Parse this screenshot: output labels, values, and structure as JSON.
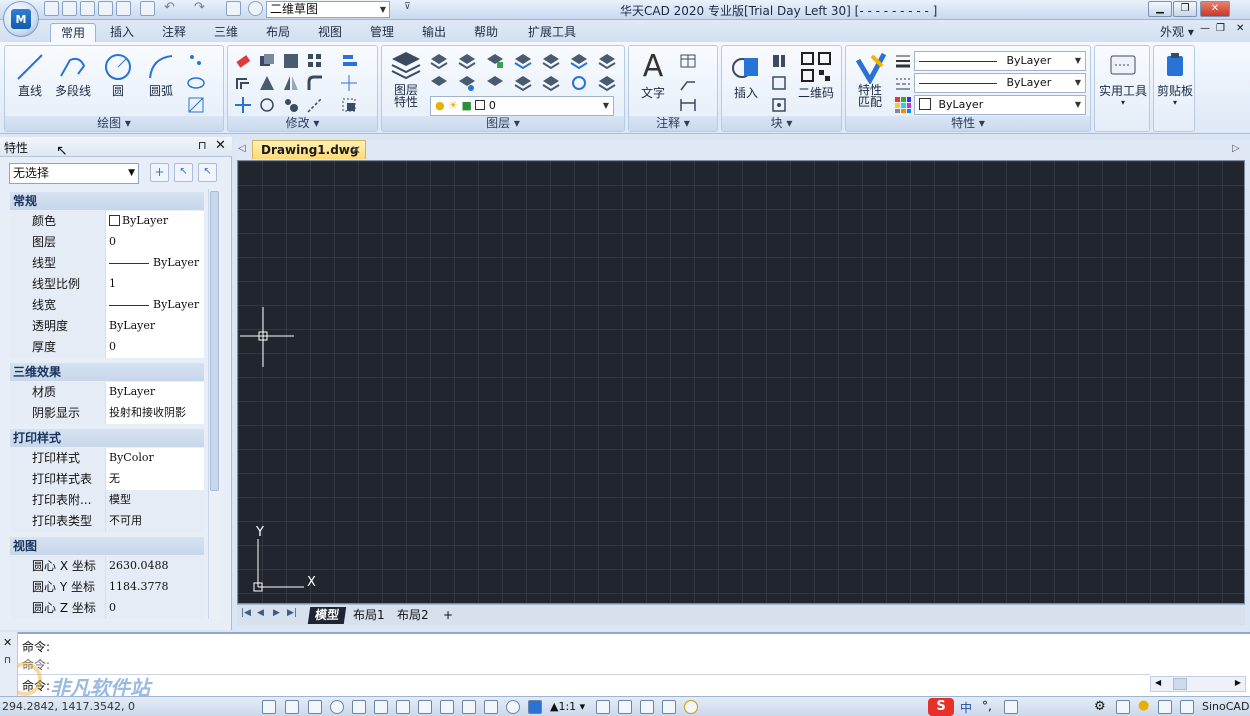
{
  "titlebar": {
    "workspace": "二维草图",
    "title": "华天CAD 2020 专业版[Trial Day Left 30]  [- - - - - - - - -  ]",
    "right_menu": "外观"
  },
  "ribbon_tabs": [
    "常用",
    "插入",
    "注释",
    "三维",
    "布局",
    "视图",
    "管理",
    "输出",
    "帮助",
    "扩展工具"
  ],
  "ribbon": {
    "draw": {
      "title": "绘图",
      "line": "直线",
      "polyline": "多段线",
      "circle": "圆",
      "arc": "圆弧"
    },
    "modify": {
      "title": "修改"
    },
    "layers": {
      "title": "图层",
      "layer_props_l1": "图层",
      "layer_props_l2": "特性",
      "current_layer": "0"
    },
    "annotate": {
      "title": "注释",
      "text": "文字"
    },
    "block": {
      "title": "块",
      "insert": "插入",
      "qrcode": "二维码"
    },
    "properties": {
      "title": "特性",
      "match_l1": "特性",
      "match_l2": "匹配",
      "lineweight": "ByLayer",
      "linetype": "ByLayer",
      "color": "ByLayer"
    },
    "utilities": {
      "label": "实用工具"
    },
    "clipboard": {
      "label": "剪贴板"
    }
  },
  "props_panel": {
    "title": "特性",
    "selection": "无选择",
    "sections": {
      "general": "常规",
      "three_d": "三维效果",
      "print": "打印样式",
      "view": "视图"
    },
    "rows": {
      "color": {
        "k": "颜色",
        "v": "ByLayer"
      },
      "layer": {
        "k": "图层",
        "v": "0"
      },
      "linetype": {
        "k": "线型",
        "v": "ByLayer"
      },
      "ltscale": {
        "k": "线型比例",
        "v": "1"
      },
      "lineweight": {
        "k": "线宽",
        "v": "ByLayer"
      },
      "transparency": {
        "k": "透明度",
        "v": "ByLayer"
      },
      "thickness": {
        "k": "厚度",
        "v": "0"
      },
      "material": {
        "k": "材质",
        "v": "ByLayer"
      },
      "shadow": {
        "k": "阴影显示",
        "v": "投射和接收阴影"
      },
      "plotstyle": {
        "k": "打印样式",
        "v": "ByColor"
      },
      "plottable": {
        "k": "打印样式表",
        "v": "无"
      },
      "plotattached": {
        "k": "打印表附...",
        "v": "模型"
      },
      "plottype": {
        "k": "打印表类型",
        "v": "不可用"
      },
      "cx": {
        "k": "圆心 X 坐标",
        "v": "2630.0488"
      },
      "cy": {
        "k": "圆心 Y 坐标",
        "v": "1184.3778"
      },
      "cz": {
        "k": "圆心 Z 坐标",
        "v": "0"
      }
    }
  },
  "document": {
    "tab": "Drawing1.dwg"
  },
  "layout_tabs": {
    "model": "模型",
    "layout1": "布局1",
    "layout2": "布局2",
    "add": "+"
  },
  "ucs": {
    "x": "X",
    "y": "Y"
  },
  "command": {
    "l1": "命令:",
    "l2": "命令:",
    "l3": "命令:"
  },
  "watermark": "非凡软件站",
  "status": {
    "coords": "294.2842, 1417.3542, 0",
    "scale": "1:1",
    "brand": "SinoCAD",
    "ime": "中"
  }
}
